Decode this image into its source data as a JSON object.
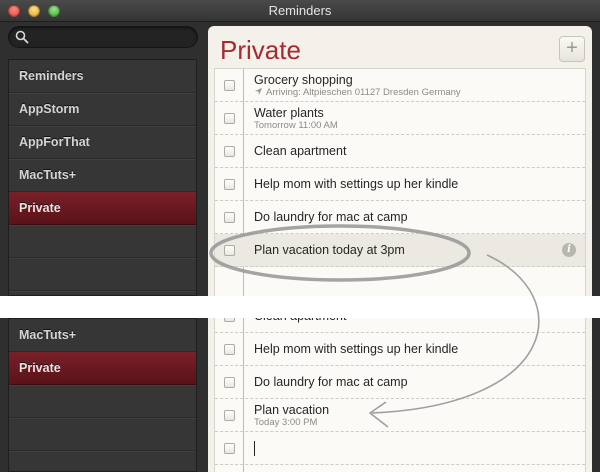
{
  "window": {
    "title": "Reminders"
  },
  "search": {
    "placeholder": ""
  },
  "sidebar_top": [
    {
      "label": "Reminders",
      "selected": false
    },
    {
      "label": "AppStorm",
      "selected": false
    },
    {
      "label": "AppForThat",
      "selected": false
    },
    {
      "label": "MacTuts+",
      "selected": false
    },
    {
      "label": "Private",
      "selected": true
    },
    {
      "label": "",
      "selected": false
    },
    {
      "label": "",
      "selected": false
    }
  ],
  "list": {
    "title": "Private",
    "add_label": "+",
    "items": [
      {
        "title": "Grocery shopping",
        "subtitle": "Arriving: Altpieschen 01127 Dresden Germany",
        "has_location": true
      },
      {
        "title": "Water plants",
        "subtitle": "Tomorrow 11:00 AM"
      },
      {
        "title": "Clean apartment",
        "subtitle": ""
      },
      {
        "title": "Help mom with settings up her kindle",
        "subtitle": ""
      },
      {
        "title": "Do laundry for mac at camp",
        "subtitle": ""
      },
      {
        "title": "Plan vacation today at 3pm",
        "subtitle": "",
        "highlighted": true,
        "info_icon": "info-icon"
      }
    ]
  },
  "sidebar_bottom": [
    {
      "label": "MacTuts+",
      "selected": false
    },
    {
      "label": "Private",
      "selected": true
    },
    {
      "label": "",
      "selected": false
    },
    {
      "label": "",
      "selected": false
    },
    {
      "label": "",
      "selected": false
    }
  ],
  "list_bottom": {
    "items": [
      {
        "title": "Clean apartment",
        "subtitle": ""
      },
      {
        "title": "Help mom with settings up her kindle",
        "subtitle": ""
      },
      {
        "title": "Do laundry for mac at camp",
        "subtitle": ""
      },
      {
        "title": "Plan vacation",
        "subtitle": "Today 3:00 PM"
      },
      {
        "title": "",
        "subtitle": "",
        "editing": true
      }
    ]
  },
  "colors": {
    "accent": "#a62a2e",
    "selected_row": "#6a1820",
    "annotation": "#9a9a9a"
  }
}
